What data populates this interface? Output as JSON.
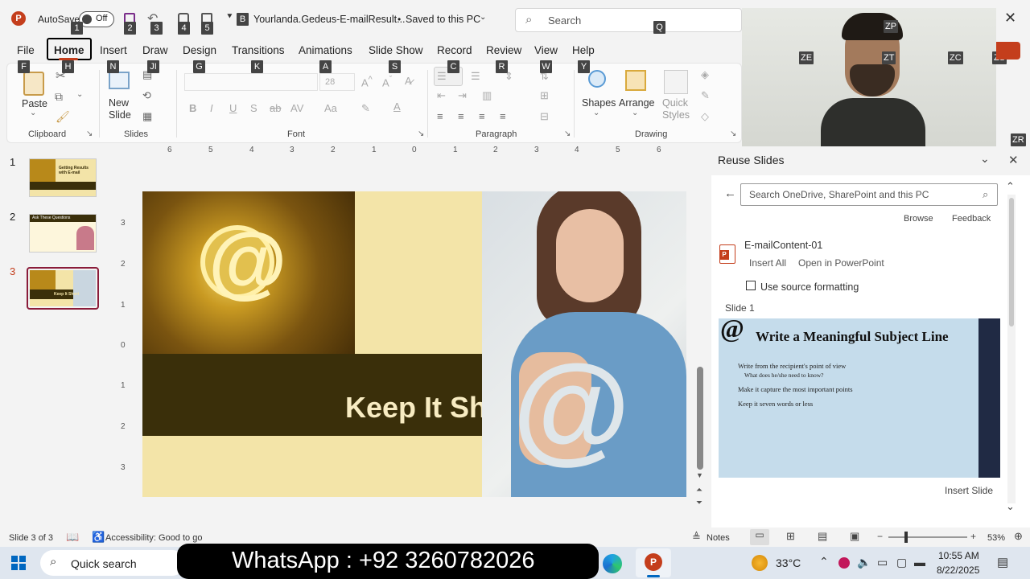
{
  "titlebar": {
    "autosave_label": "AutoSave",
    "autosave_state": "Off",
    "filename": "Yourlanda.Gedeus-E-mailResult...",
    "saved_status": "Saved to this PC",
    "search_placeholder": "Search"
  },
  "tabs": [
    "File",
    "Home",
    "Insert",
    "Draw",
    "Design",
    "Transitions",
    "Animations",
    "Slide Show",
    "Record",
    "Review",
    "View",
    "Help"
  ],
  "keytips": {
    "autosave": "1",
    "save": "2",
    "undo": "3",
    "redo": "4",
    "present": "5",
    "qat_file": "B",
    "search": "Q",
    "file": "F",
    "home": "H",
    "insert": "N",
    "draw": "JI",
    "design": "G",
    "transitions": "K",
    "animations": "A",
    "slideshow": "S",
    "record": "C",
    "review": "R",
    "view": "W",
    "help": "Y",
    "zp": "ZP",
    "ze": "ZE",
    "zt": "ZT",
    "zc": "ZC",
    "zs": "ZS",
    "zr": "ZR"
  },
  "ribbon": {
    "paste": "Paste",
    "new_slide": "New\nSlide",
    "font_size": "28",
    "shapes": "Shapes",
    "arrange": "Arrange",
    "quick_styles": "Quick\nStyles",
    "groups": {
      "clipboard": "Clipboard",
      "slides": "Slides",
      "font": "Font",
      "paragraph": "Paragraph",
      "drawing": "Drawing"
    }
  },
  "ruler_labels": [
    "6",
    "5",
    "4",
    "3",
    "2",
    "1",
    "0",
    "1",
    "2",
    "3",
    "4",
    "5",
    "6"
  ],
  "vruler_labels": [
    "3",
    "2",
    "1",
    "0",
    "1",
    "2",
    "3"
  ],
  "slides_panel": {
    "numbers": [
      "1",
      "2",
      "3"
    ],
    "thumb1_title": "Getting Results with E-mail",
    "thumb2_title": "Ask These Questions",
    "thumb3_title": "Keep It Short"
  },
  "slide": {
    "title": "Keep It Sh",
    "at_symbol": "@"
  },
  "reuse": {
    "title": "Reuse Slides",
    "search_placeholder": "Search OneDrive, SharePoint and this PC",
    "browse": "Browse",
    "feedback": "Feedback",
    "file_name": "E-mailContent-01",
    "insert_all": "Insert All",
    "open_in": "Open in PowerPoint",
    "use_source": "Use source formatting",
    "slide_label": "Slide 1",
    "preview_title": "Write a Meaningful Subject Line",
    "preview_bullets": [
      "Write from the recipient's point of view",
      "What does he/she need to know?",
      "Make it capture the most important points",
      "Keep it seven words or less"
    ],
    "insert_slide": "Insert Slide"
  },
  "status": {
    "slide_info": "Slide 3 of 3",
    "accessibility": "Accessibility: Good to go",
    "notes": "Notes",
    "zoom": "53%"
  },
  "taskbar": {
    "search": "Quick search",
    "overlay": "WhatsApp : +92 3260782026",
    "temp": "33°C",
    "time": "10:55 AM",
    "date": "8/22/2025"
  },
  "colors": {
    "accent": "#c43e1c",
    "slide_dark": "#3a2f0a",
    "slide_bg": "#f3e4a8",
    "gold": "#b8891a",
    "preview_bg": "#c5dceb"
  }
}
